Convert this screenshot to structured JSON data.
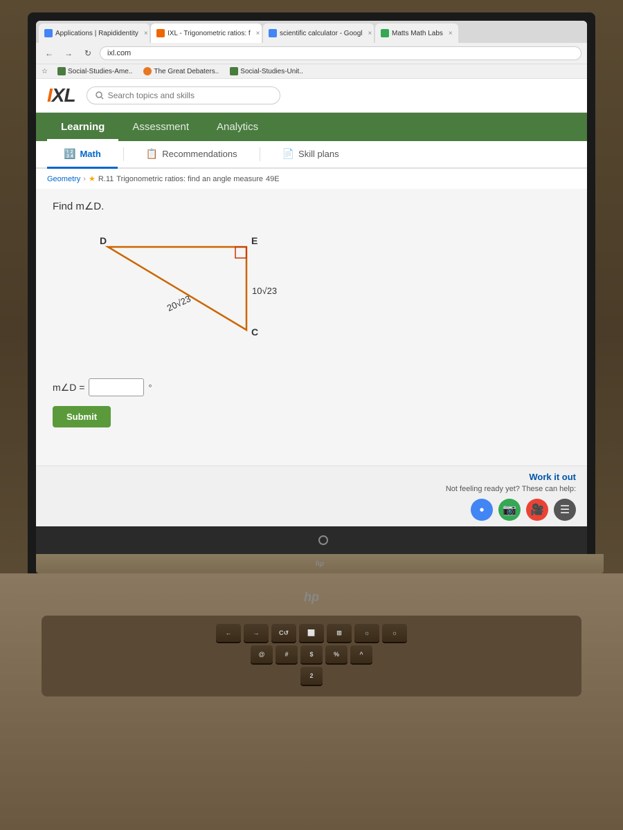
{
  "browser": {
    "tabs": [
      {
        "id": "t1",
        "label": "Applications | Rapididentity",
        "active": false,
        "favicon_color": "#4285f4"
      },
      {
        "id": "t2",
        "label": "IXL - Trigonometric ratios: f",
        "active": true,
        "favicon_color": "#ee6600"
      },
      {
        "id": "t3",
        "label": "scientific calculator - Googl",
        "active": false,
        "favicon_color": "#4285f4"
      },
      {
        "id": "t4",
        "label": "Matts Math Labs",
        "active": false,
        "favicon_color": "#34a853"
      }
    ],
    "address": "ixl.com",
    "bookmarks": [
      {
        "label": "Social-Studies-Ame..",
        "icon_color": "#4a7c3f"
      },
      {
        "label": "The Great Debaters..",
        "icon_color": "#e87722"
      },
      {
        "label": "Social-Studies-Unit..",
        "icon_color": "#4a7c3f"
      }
    ]
  },
  "ixl": {
    "logo": "IXL",
    "search_placeholder": "Search topics and skills",
    "nav": [
      {
        "id": "learning",
        "label": "Learning",
        "active": true
      },
      {
        "id": "assessment",
        "label": "Assessment",
        "active": false
      },
      {
        "id": "analytics",
        "label": "Analytics",
        "active": false
      }
    ],
    "subnav": [
      {
        "id": "math",
        "label": "Math",
        "icon": "🔢",
        "active": true
      },
      {
        "id": "recommendations",
        "label": "Recommendations",
        "icon": "📋",
        "active": false
      },
      {
        "id": "skill_plans",
        "label": "Skill plans",
        "icon": "📄",
        "active": false
      }
    ],
    "breadcrumb": {
      "subject": "Geometry",
      "skill_code": "R.11",
      "skill_name": "Trigonometric ratios: find an angle measure",
      "problem_number": "49E"
    },
    "problem": {
      "instruction": "Find m∠D.",
      "vertices": {
        "D": "D",
        "E": "E",
        "C": "C"
      },
      "sides": {
        "hypotenuse_label": "20√23",
        "leg_label": "10√23"
      },
      "answer_label": "m∠D =",
      "degree_symbol": "°",
      "submit_label": "Submit"
    },
    "work_it_out": {
      "title": "Work it out",
      "subtitle": "Not feeling ready yet? These can help:"
    }
  },
  "taskbar": {
    "items": [
      "chrome",
      "video-camera",
      "video-camera-2",
      "menu"
    ]
  },
  "hp_logo": "hp",
  "keyboard": {
    "rows": [
      [
        "←",
        "→",
        "C↺",
        "⬜",
        "⊞",
        "☼",
        "☼"
      ],
      [
        "@",
        "#",
        "$",
        "%",
        "^"
      ]
    ]
  }
}
